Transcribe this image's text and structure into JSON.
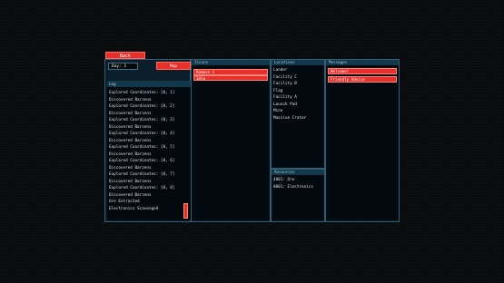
{
  "back_button": "Back",
  "day_field": "Day: 1",
  "map_button": "Map",
  "log": {
    "title": "Log",
    "lines": [
      "Explored Coordinates: [0, 1]",
      "Discovered Barzens",
      "Explored Coordinates: [0, 2]",
      "Discovered Barzens",
      "Explored Coordinates: [0, 3]",
      "Discovered Barzens",
      "Explored Coordinates: [0, 4]",
      "Discovered Barzens",
      "Explored Coordinates: [0, 5]",
      "Discovered Barzens",
      "Explored Coordinates: [0, 6]",
      "Discovered Barzens",
      "Explored Coordinates: [0, 7]",
      "Discovered Barzens",
      "Explored Coordinates: [0, 8]",
      "Discovered Barzens",
      "Ore Extracted",
      "Electronics Scavenged"
    ]
  },
  "issues": {
    "title": "Issues",
    "items": [
      "Remove 1",
      "Idle"
    ]
  },
  "locations": {
    "title": "Locations",
    "items": [
      "Lander",
      "Facility C",
      "Facility B",
      "Flag",
      "Facility A",
      "Launch Pad",
      "Mine",
      "Massive Crater"
    ]
  },
  "resources": {
    "title": "Resources",
    "items": [
      "4001: Ore",
      "0001: Electronics"
    ]
  },
  "messages": {
    "title": "Messages",
    "items": [
      "Welcome!",
      "Friendly Advice"
    ]
  }
}
